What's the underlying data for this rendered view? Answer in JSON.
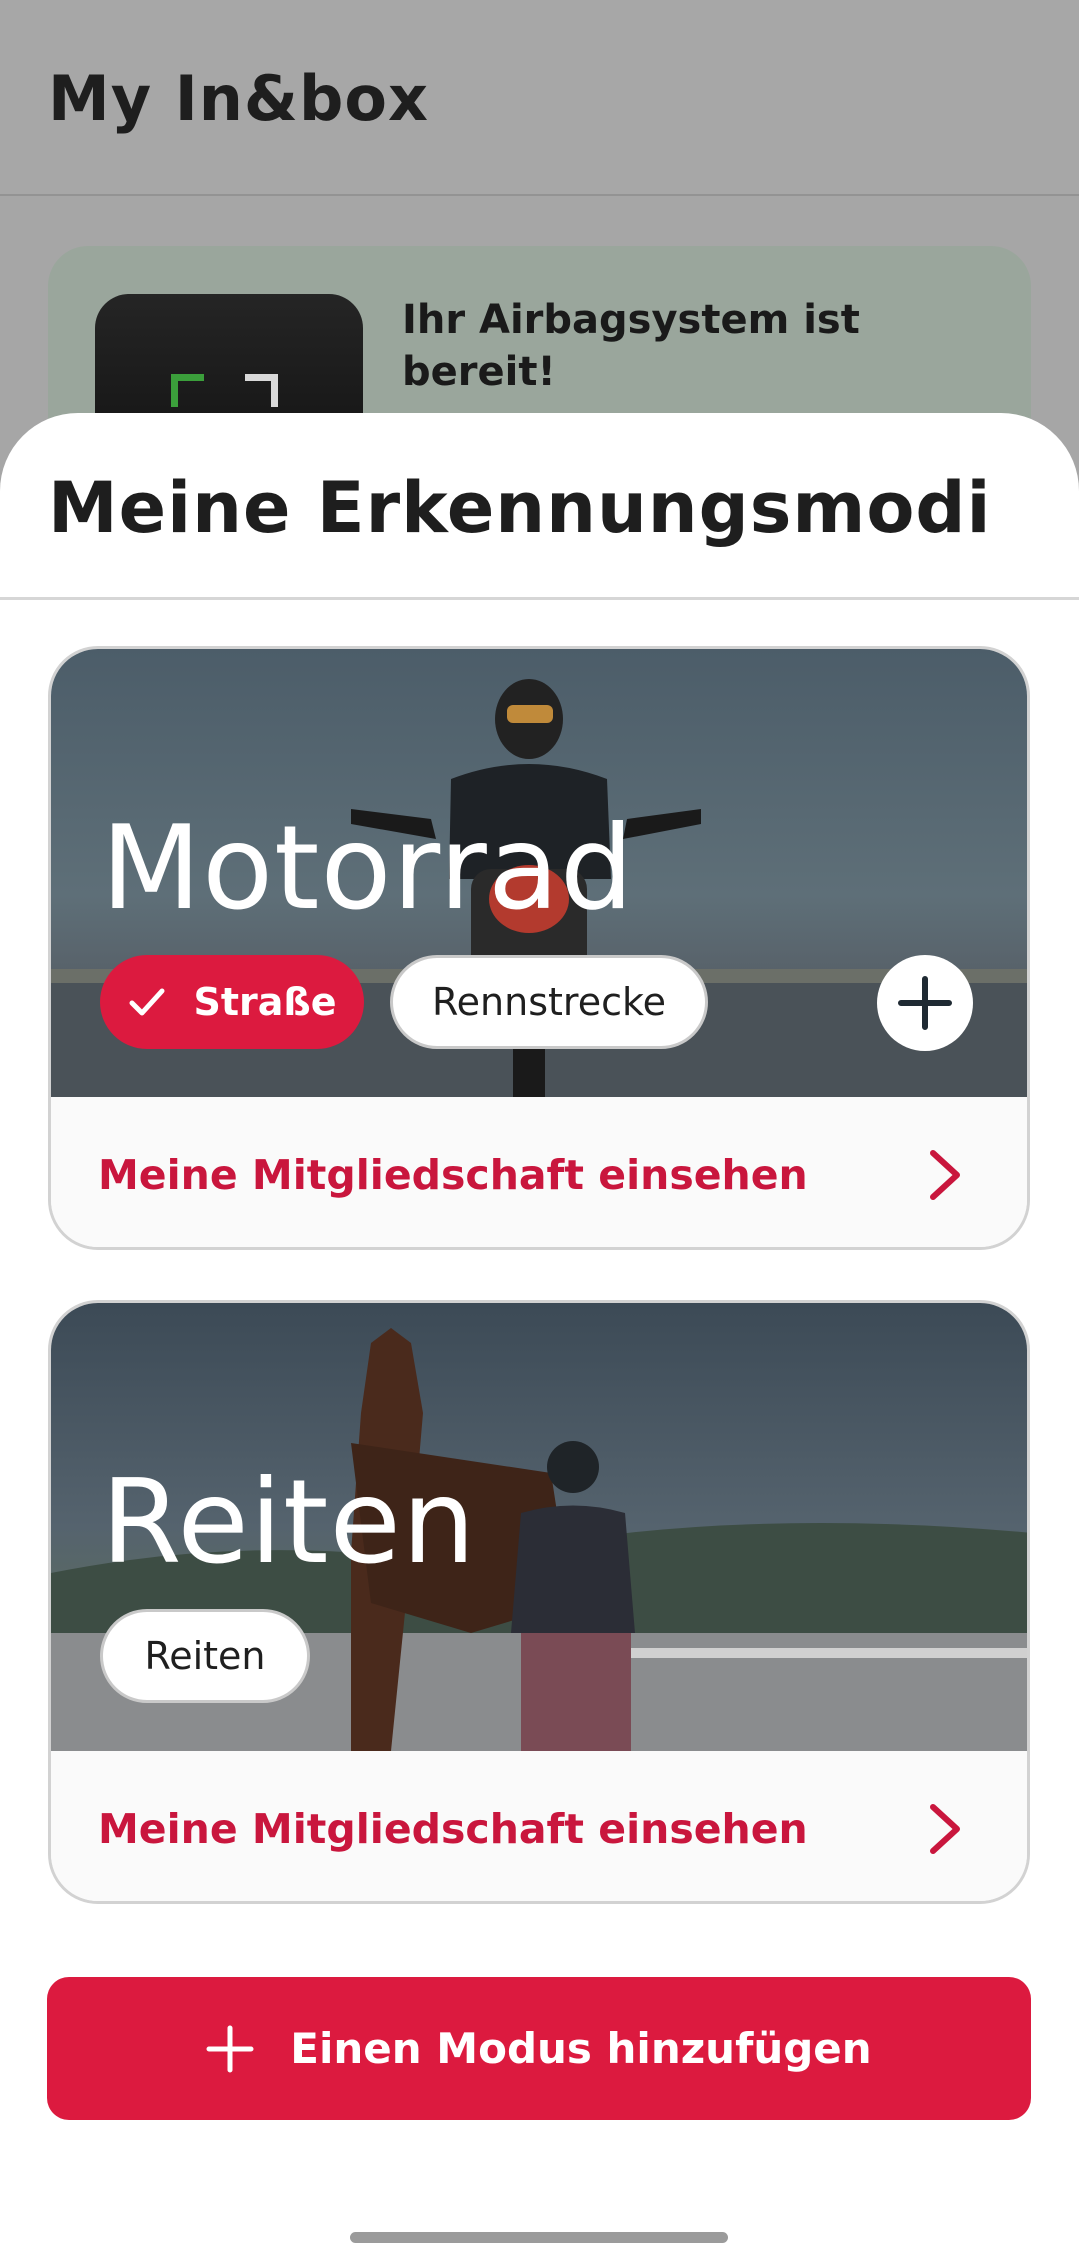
{
  "background": {
    "title": "My In&box",
    "status_card_text": "Ihr Airbagsystem ist bereit!"
  },
  "sheet": {
    "title": "Meine Erkennungsmodi",
    "modes": [
      {
        "name": "Motorrad",
        "chips": [
          {
            "label": "Straße",
            "active": true
          },
          {
            "label": "Rennstrecke",
            "active": false
          }
        ],
        "footer_link": "Meine Mitgliedschaft einsehen"
      },
      {
        "name": "Reiten",
        "chips": [
          {
            "label": "Reiten",
            "active": false
          }
        ],
        "footer_link": "Meine Mitgliedschaft einsehen"
      }
    ],
    "add_mode_label": "Einen Modus hinzufügen"
  },
  "colors": {
    "accent": "#dc1a3f",
    "link": "#c9163d"
  },
  "icons": [
    "check-icon",
    "plus-icon",
    "chevron-right-icon"
  ]
}
